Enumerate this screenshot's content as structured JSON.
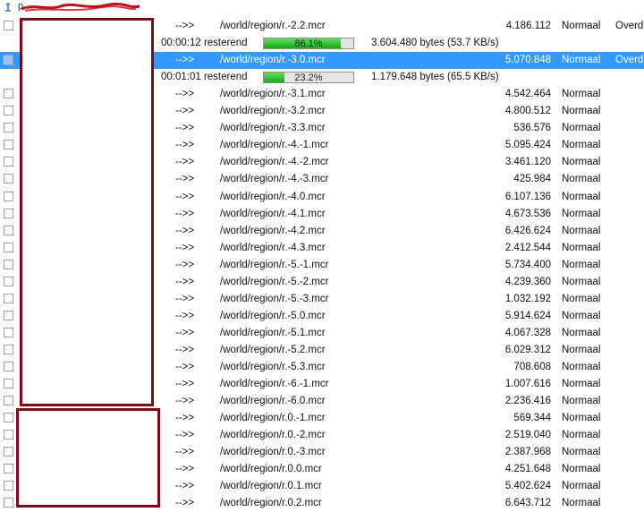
{
  "header": {
    "partial_text": "p…",
    "ellipsis": "…"
  },
  "rows": [
    {
      "arrow": "-->>",
      "path": "/world/region/r.-2.2.mcr",
      "size": "4.186.112",
      "priority": "Normaal",
      "status": "Overd",
      "selected": false
    },
    {
      "arrow": "-->>",
      "path": "/world/region/r.-3.0.mcr",
      "size": "5.070.848",
      "priority": "Normaal",
      "status": "Overd",
      "selected": true
    },
    {
      "arrow": "-->>",
      "path": "/world/region/r.-3.1.mcr",
      "size": "4.542.464",
      "priority": "Normaal",
      "status": "",
      "selected": false
    },
    {
      "arrow": "-->>",
      "path": "/world/region/r.-3.2.mcr",
      "size": "4.800.512",
      "priority": "Normaal",
      "status": "",
      "selected": false
    },
    {
      "arrow": "-->>",
      "path": "/world/region/r.-3.3.mcr",
      "size": "536.576",
      "priority": "Normaal",
      "status": "",
      "selected": false
    },
    {
      "arrow": "-->>",
      "path": "/world/region/r.-4.-1.mcr",
      "size": "5.095.424",
      "priority": "Normaal",
      "status": "",
      "selected": false
    },
    {
      "arrow": "-->>",
      "path": "/world/region/r.-4.-2.mcr",
      "size": "3.461.120",
      "priority": "Normaal",
      "status": "",
      "selected": false
    },
    {
      "arrow": "-->>",
      "path": "/world/region/r.-4.-3.mcr",
      "size": "425.984",
      "priority": "Normaal",
      "status": "",
      "selected": false
    },
    {
      "arrow": "-->>",
      "path": "/world/region/r.-4.0.mcr",
      "size": "6.107.136",
      "priority": "Normaal",
      "status": "",
      "selected": false
    },
    {
      "arrow": "-->>",
      "path": "/world/region/r.-4.1.mcr",
      "size": "4.673.536",
      "priority": "Normaal",
      "status": "",
      "selected": false
    },
    {
      "arrow": "-->>",
      "path": "/world/region/r.-4.2.mcr",
      "size": "6.426.624",
      "priority": "Normaal",
      "status": "",
      "selected": false
    },
    {
      "arrow": "-->>",
      "path": "/world/region/r.-4.3.mcr",
      "size": "2.412.544",
      "priority": "Normaal",
      "status": "",
      "selected": false
    },
    {
      "arrow": "-->>",
      "path": "/world/region/r.-5.-1.mcr",
      "size": "5.734.400",
      "priority": "Normaal",
      "status": "",
      "selected": false
    },
    {
      "arrow": "-->>",
      "path": "/world/region/r.-5.-2.mcr",
      "size": "4.239.360",
      "priority": "Normaal",
      "status": "",
      "selected": false
    },
    {
      "arrow": "-->>",
      "path": "/world/region/r.-5.-3.mcr",
      "size": "1.032.192",
      "priority": "Normaal",
      "status": "",
      "selected": false
    },
    {
      "arrow": "-->>",
      "path": "/world/region/r.-5.0.mcr",
      "size": "5.914.624",
      "priority": "Normaal",
      "status": "",
      "selected": false
    },
    {
      "arrow": "-->>",
      "path": "/world/region/r.-5.1.mcr",
      "size": "4.067.328",
      "priority": "Normaal",
      "status": "",
      "selected": false
    },
    {
      "arrow": "-->>",
      "path": "/world/region/r.-5.2.mcr",
      "size": "6.029.312",
      "priority": "Normaal",
      "status": "",
      "selected": false
    },
    {
      "arrow": "-->>",
      "path": "/world/region/r.-5.3.mcr",
      "size": "708.608",
      "priority": "Normaal",
      "status": "",
      "selected": false
    },
    {
      "arrow": "-->>",
      "path": "/world/region/r.-6.-1.mcr",
      "size": "1.007.616",
      "priority": "Normaal",
      "status": "",
      "selected": false
    },
    {
      "arrow": "-->>",
      "path": "/world/region/r.-6.0.mcr",
      "size": "2.236.416",
      "priority": "Normaal",
      "status": "",
      "selected": false
    },
    {
      "arrow": "-->>",
      "path": "/world/region/r.0.-1.mcr",
      "size": "569.344",
      "priority": "Normaal",
      "status": "",
      "selected": false
    },
    {
      "arrow": "-->>",
      "path": "/world/region/r.0.-2.mcr",
      "size": "2.519.040",
      "priority": "Normaal",
      "status": "",
      "selected": false
    },
    {
      "arrow": "-->>",
      "path": "/world/region/r.0.-3.mcr",
      "size": "2.387.968",
      "priority": "Normaal",
      "status": "",
      "selected": false
    },
    {
      "arrow": "-->>",
      "path": "/world/region/r.0.0.mcr",
      "size": "4.251.648",
      "priority": "Normaal",
      "status": "",
      "selected": false
    },
    {
      "arrow": "-->>",
      "path": "/world/region/r.0.1.mcr",
      "size": "5.402.624",
      "priority": "Normaal",
      "status": "",
      "selected": false
    },
    {
      "arrow": "-->>",
      "path": "/world/region/r.0.2.mcr",
      "size": "6.643.712",
      "priority": "Normaal",
      "status": "",
      "selected": false
    }
  ],
  "progress": [
    {
      "after_row": 0,
      "remaining": "00:00:12 resterend",
      "percent": 86.1,
      "percent_text": "86.1%",
      "bytes": "3.604.480 bytes (53.7 KB/s)"
    },
    {
      "after_row": 1,
      "remaining": "00:01:01 resterend",
      "percent": 23.2,
      "percent_text": "23.2%",
      "bytes": "1.179.648 bytes (65.5 KB/s)"
    }
  ],
  "colors": {
    "selection": "#3399ff",
    "progress_fill": "#1aa81a",
    "redaction_border": "#7b0c18",
    "scribble": "#c0101c"
  }
}
